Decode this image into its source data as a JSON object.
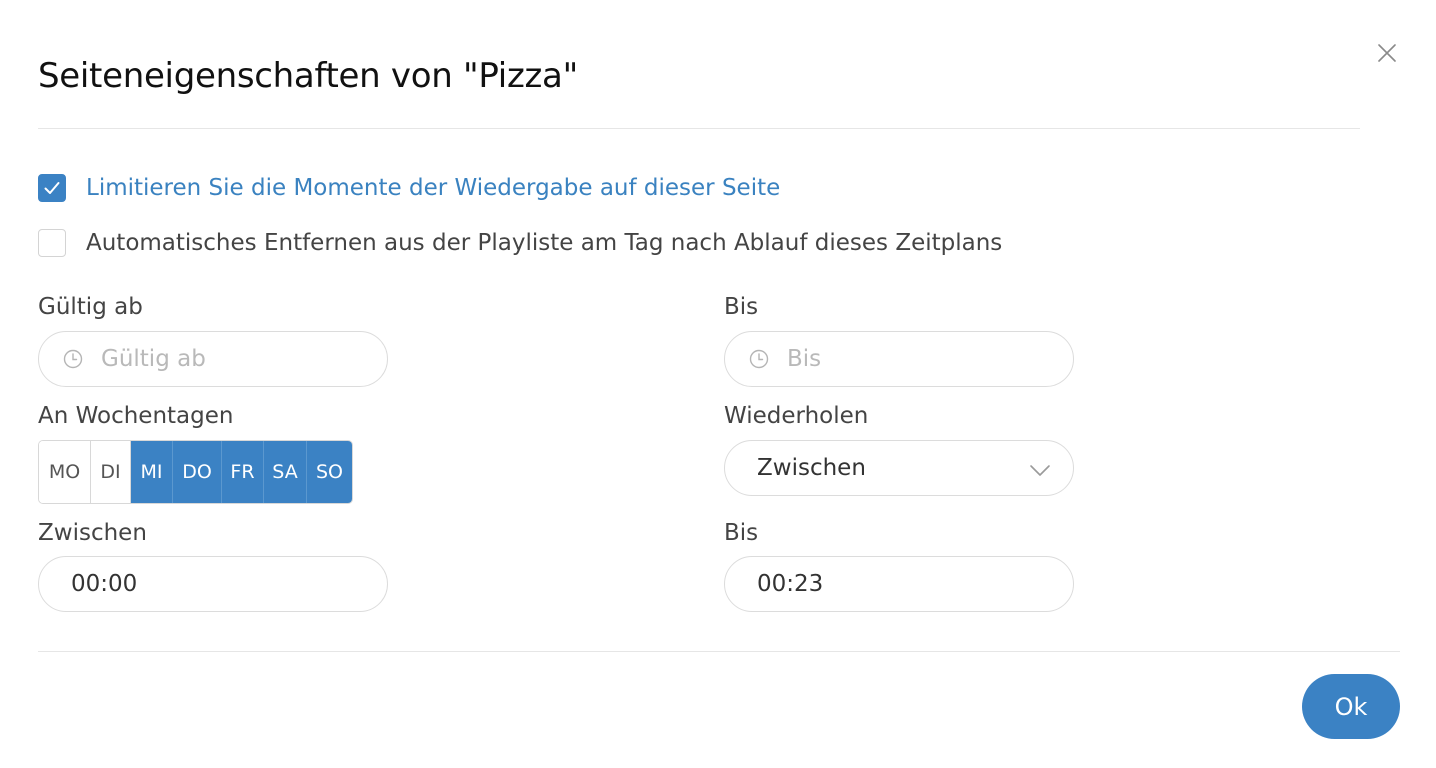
{
  "dialog": {
    "title": "Seiteneigenschaften von \"Pizza\""
  },
  "options": {
    "limit_label": "Limitieren Sie die Momente der Wiedergabe auf dieser Seite",
    "limit_checked": true,
    "autoremove_label": "Automatisches Entfernen aus der Playliste am Tag nach Ablauf dieses Zeitplans",
    "autoremove_checked": false
  },
  "valid_from": {
    "label": "Gültig ab",
    "placeholder": "Gültig ab"
  },
  "valid_to": {
    "label": "Bis",
    "placeholder": "Bis"
  },
  "weekdays": {
    "label": "An Wochentagen",
    "days": [
      {
        "label": "MO",
        "active": false
      },
      {
        "label": "DI",
        "active": false
      },
      {
        "label": "MI",
        "active": true
      },
      {
        "label": "DO",
        "active": true
      },
      {
        "label": "FR",
        "active": true
      },
      {
        "label": "SA",
        "active": true
      },
      {
        "label": "SO",
        "active": true
      }
    ]
  },
  "repeat": {
    "label": "Wiederholen",
    "selected": "Zwischen"
  },
  "time_from": {
    "label": "Zwischen",
    "value": "00:00"
  },
  "time_to": {
    "label": "Bis",
    "value": "00:23"
  },
  "footer": {
    "ok_label": "Ok"
  },
  "colors": {
    "accent": "#3b82c4",
    "link_text": "#3a82c0",
    "border": "#dcdcdc"
  },
  "icons": {
    "close": "close-icon",
    "check": "check-icon",
    "clock": "clock-icon",
    "chevron": "chevron-down-icon"
  }
}
